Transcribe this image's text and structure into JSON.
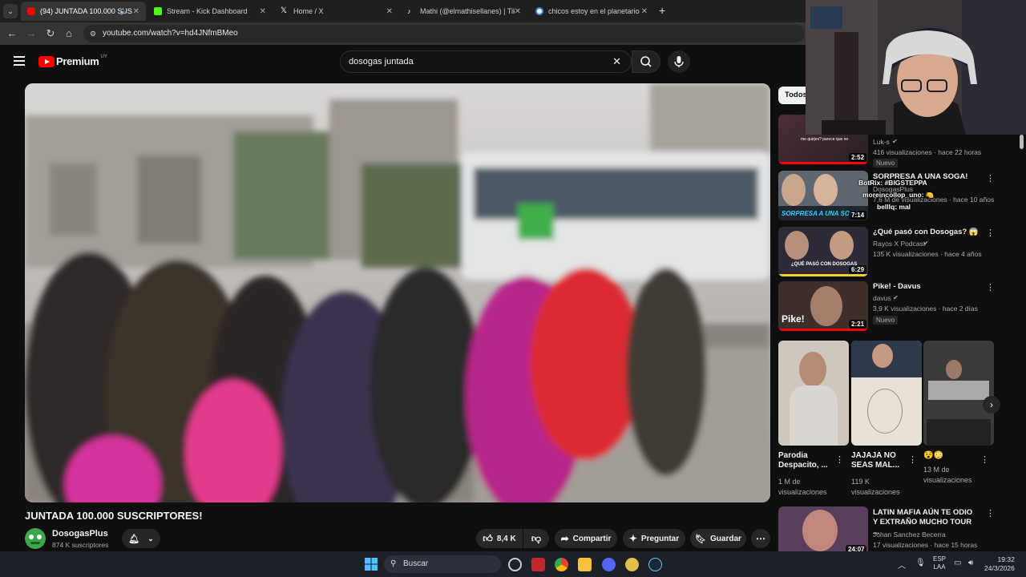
{
  "browser": {
    "tabs": [
      {
        "label": "(94) JUNTADA 100.000 SUS",
        "favicon_color": "#ff0000",
        "active": true
      },
      {
        "label": "Stream - Kick Dashboard",
        "favicon_color": "#53fc18"
      },
      {
        "label": "Home / X",
        "favicon_color": "#ffffff"
      },
      {
        "label": "Mathi (@elmathisellanes) | TikTok",
        "favicon_color": "#ffffff"
      },
      {
        "label": "chicos estoy en el planetario - Búsqueda de Google",
        "favicon_color": "#4285f4"
      }
    ],
    "new_tab": "+",
    "url": "youtube.com/watch?v=hd4JNfmBMeo"
  },
  "youtube": {
    "logo": "Premium",
    "country": "UY",
    "search_value": "dosogas juntada",
    "video_title": "JUNTADA 100.000 SUSCRIPTORES!",
    "channel": "DosogasPlus",
    "subscribers": "874 K suscriptores",
    "likes": "8,4 K",
    "share": "Compartir",
    "ask": "Preguntar",
    "save": "Guardar",
    "filter_chip": "Todos"
  },
  "related": [
    {
      "title": "",
      "channel": "Luk-s",
      "meta": "416 visualizaciones · hace 22 horas",
      "badge": "Nuevo",
      "duration": "2:52",
      "thumb_text": "me quejes? parece que no"
    },
    {
      "title": "SORPRESA A UNA SOGA!",
      "channel": "DosogasPlus",
      "meta": "7,6 M de visualizaciones · hace 10 años",
      "duration": "7:14",
      "thumb_text": "SORPRESA A UNA SOGA"
    },
    {
      "title": "¿Qué pasó con Dosogas? 😱",
      "channel": "Rayos X Podcast",
      "meta": "135 K visualizaciones · hace 4 años",
      "duration": "6:29",
      "thumb_text": "¿QUÉ PASÓ CON DOSOGAS"
    },
    {
      "title": "Pike! - Davus",
      "channel": "davus",
      "meta": "3,9 K visualizaciones · hace 2 días",
      "badge": "Nuevo",
      "duration": "2:21",
      "thumb_text": "Pike!"
    },
    {
      "title": "LATIN MAFIA AÚN TE ODIO Y EXTRAÑO MUCHO TOUR ...",
      "channel": "Johan Sanchez Becerra",
      "meta": "17 visualizaciones · hace 15 horas",
      "duration": "24:07"
    }
  ],
  "shorts": [
    {
      "title": "Parodia Despacito, ...",
      "views": "1 M de visualizaciones"
    },
    {
      "title": "JAJAJA NO SEAS MAL...",
      "views": "119 K visualizaciones"
    },
    {
      "title": "😵😳",
      "views": "13 M de visualizaciones"
    }
  ],
  "chat": [
    {
      "user": "BotRix",
      "text": ": #BIGSTEPPA"
    },
    {
      "user": "moreincollop_uno",
      "text": ": 🍋"
    },
    {
      "user": "bellIq",
      "text": ": mal"
    }
  ],
  "taskbar": {
    "search_placeholder": "Buscar",
    "lang": "ESP",
    "region": "LAA",
    "time": "19:32",
    "date": "24/3/2026"
  },
  "colors": {
    "accent_red": "#ff0000",
    "bg": "#0f0f0f"
  }
}
